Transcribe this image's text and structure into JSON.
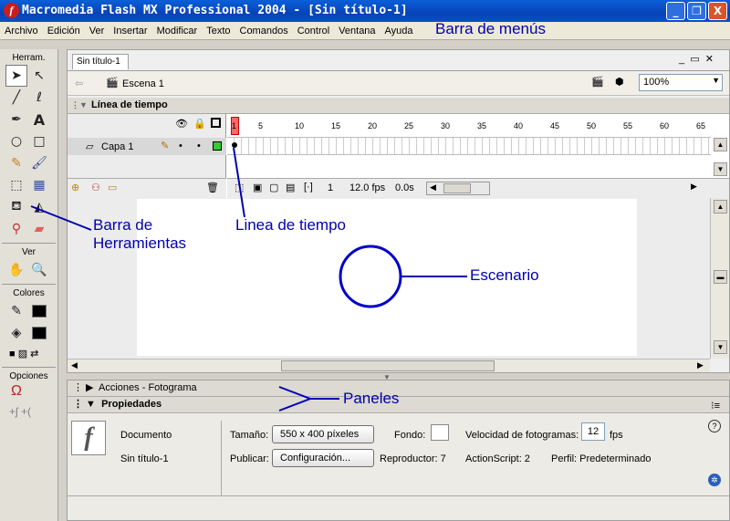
{
  "window": {
    "title": "Macromedia Flash MX Professional 2004 - [Sin título-1]",
    "minimize": "_",
    "restore": "❐",
    "close": "X"
  },
  "menubar": {
    "items": [
      "Archivo",
      "Edición",
      "Ver",
      "Insertar",
      "Modificar",
      "Texto",
      "Comandos",
      "Control",
      "Ventana",
      "Ayuda"
    ],
    "annotation": "Barra de menús"
  },
  "tools": {
    "header": "Herram.",
    "view_header": "Ver",
    "colors_header": "Colores",
    "options_header": "Opciones"
  },
  "document": {
    "tab": "Sin título-1",
    "scene": "Escena 1",
    "zoom": "100%"
  },
  "timeline": {
    "title": "Línea de tiempo",
    "frame_numbers": [
      "1",
      "5",
      "10",
      "15",
      "20",
      "25",
      "30",
      "35",
      "40",
      "45",
      "50",
      "55",
      "60",
      "65"
    ],
    "layer_name": "Capa 1",
    "current_frame": "1",
    "fps": "12.0 fps",
    "time": "0.0s"
  },
  "panels": {
    "actions_title": "Acciones - Fotograma",
    "properties_title": "Propiedades",
    "doc_type": "Documento",
    "doc_name": "Sin título-1",
    "size_label": "Tamaño:",
    "size_value": "550 x 400 píxeles",
    "background_label": "Fondo:",
    "fps_label": "Velocidad de fotogramas:",
    "fps_value": "12",
    "fps_unit": "fps",
    "publish_label": "Publicar:",
    "config_button": "Configuración...",
    "player_label": "Reproductor: 7",
    "actionscript_label": "ActionScript: 2",
    "profile_label": "Perfil: Predeterminado"
  },
  "annotations": {
    "toolbar": "Barra de\nHerramientas",
    "timeline": "Linea de tiempo",
    "stage": "Escenario",
    "panels": "Paneles"
  },
  "colors": {
    "annotation": "#0000b0",
    "playhead": "#ff6666",
    "layer_green": "#33cc33"
  }
}
